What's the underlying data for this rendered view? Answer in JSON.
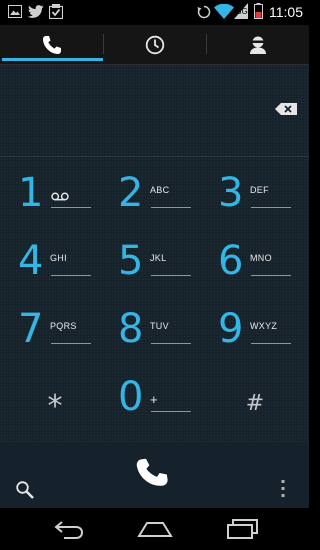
{
  "status_bar": {
    "time": "11:05",
    "left_icons": [
      "picture-icon",
      "twitter-icon",
      "download-icon"
    ],
    "right_icons": [
      "sync-icon",
      "wifi-icon",
      "signal-icon",
      "battery-icon"
    ]
  },
  "tabs": [
    {
      "name": "phone",
      "icon": "phone-icon",
      "selected": true
    },
    {
      "name": "call-log",
      "icon": "clock-icon",
      "selected": false
    },
    {
      "name": "contacts",
      "icon": "person-icon",
      "selected": false
    }
  ],
  "digits": {
    "value": ""
  },
  "keypad": [
    {
      "digit": "1",
      "letters": "",
      "icon": "voicemail-icon"
    },
    {
      "digit": "2",
      "letters": "ABC"
    },
    {
      "digit": "3",
      "letters": "DEF"
    },
    {
      "digit": "4",
      "letters": "GHI"
    },
    {
      "digit": "5",
      "letters": "JKL"
    },
    {
      "digit": "6",
      "letters": "MNO"
    },
    {
      "digit": "7",
      "letters": "PQRS"
    },
    {
      "digit": "8",
      "letters": "TUV"
    },
    {
      "digit": "9",
      "letters": "WXYZ"
    },
    {
      "digit": "*",
      "letters": ""
    },
    {
      "digit": "0",
      "letters": "+"
    },
    {
      "digit": "#",
      "letters": ""
    }
  ],
  "actions": {
    "search_icon": "search-icon",
    "call_icon": "phone-icon",
    "overflow_icon": "overflow-menu-icon"
  },
  "nav": [
    "back-icon",
    "home-icon",
    "recent-apps-icon"
  ],
  "colors": {
    "accent": "#33b5e5",
    "background": "#15222b",
    "call_green": "#a4c639"
  }
}
